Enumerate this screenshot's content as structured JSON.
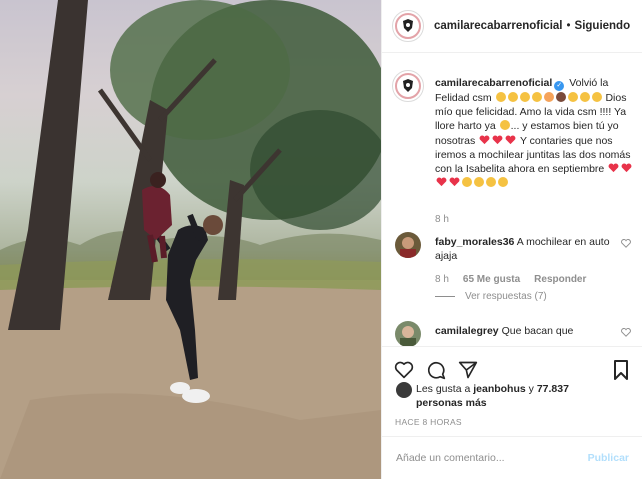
{
  "header": {
    "username": "camilarecabarrenoficial",
    "separator": "•",
    "follow_status": "Siguiendo"
  },
  "caption": {
    "username": "camilarecabarrenoficial",
    "text_line1": "Volvió la",
    "text_line2": "Felidad csm",
    "text_line3": "Dios mío que felicidad. Amo la vida csm !!!! Ya llore harto ya",
    "text_line4": "... y estamos bien tú yo nosotras",
    "text_line5": "Y contaries que nos iremos a mochilear juntitas las dos nomás con la Isabelita ahora en septiembre",
    "time": "8 h"
  },
  "comments": [
    {
      "username": "faby_morales36",
      "text": "A mochilear en auto ajaja",
      "time": "8 h",
      "likes": "65 Me gusta",
      "reply_label": "Responder",
      "view_replies": "Ver respuestas (7)"
    },
    {
      "username": "camilalegrey",
      "text": "Que bacan que"
    }
  ],
  "likes": {
    "text_prefix": "Les gusta a",
    "user": "jeanbohus",
    "text_mid": "y",
    "count": "77.837 personas más"
  },
  "posted_ago": "HACE 8 HORAS",
  "composer": {
    "placeholder": "Añade un comentario...",
    "post_label": "Publicar"
  },
  "icons": {
    "verified": "verified-badge-icon",
    "like": "heart-outline-icon",
    "comment": "comment-bubble-icon",
    "share": "paper-plane-icon",
    "save": "bookmark-icon"
  },
  "colors": {
    "verified": "#3897f0",
    "heart_emoji": "#e8334a",
    "face_emoji": "#f5c242",
    "post_disabled": "#b2dffc"
  }
}
